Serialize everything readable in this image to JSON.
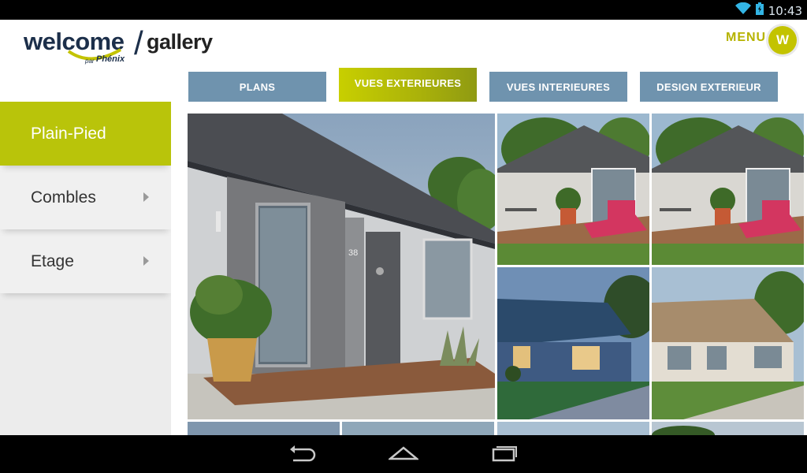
{
  "status_bar": {
    "time": "10:43",
    "icons": [
      "wifi-icon",
      "battery-icon"
    ]
  },
  "header": {
    "logo": {
      "brand": "welcome",
      "separator": "/",
      "product": "gallery",
      "by": "par",
      "company": "Phénix"
    },
    "menu_label": "MENU",
    "avatar_letter": "W"
  },
  "tabs": [
    {
      "label": "PLANS",
      "active": false
    },
    {
      "label": "VUES EXTERIEURES",
      "active": true
    },
    {
      "label": "VUES INTERIEURES",
      "active": false
    },
    {
      "label": "DESIGN EXTERIEUR",
      "active": false
    }
  ],
  "sidebar": {
    "items": [
      {
        "label": "Plain-Pied",
        "active": true
      },
      {
        "label": "Combles",
        "active": false
      },
      {
        "label": "Etage",
        "active": false
      }
    ]
  },
  "gallery": {
    "house_number": "38",
    "images": [
      "house-entrance-render",
      "terrace-with-lounger-render",
      "terrace-with-lounger-render",
      "house-evening-render",
      "house-beige-render"
    ]
  },
  "colors": {
    "accent": "#b9c40a",
    "tab": "#6f93ae",
    "brand_navy": "#1c2f4a"
  },
  "navigation_bar": {
    "buttons": [
      "back-icon",
      "home-icon",
      "recents-icon"
    ]
  }
}
